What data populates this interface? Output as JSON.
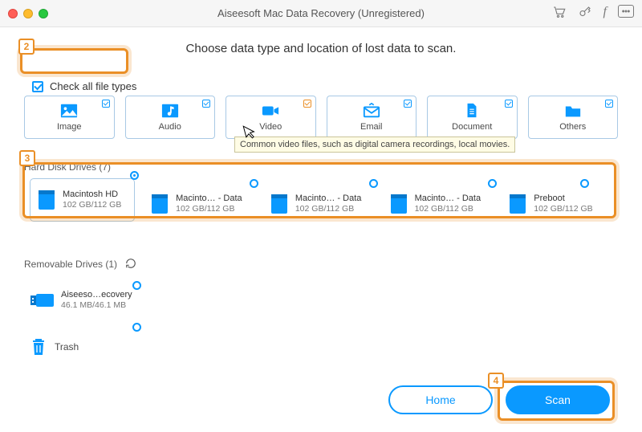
{
  "window": {
    "title": "Aiseesoft Mac Data Recovery (Unregistered)"
  },
  "instruction": "Choose data type and location of lost data to scan.",
  "checkAllLabel": "Check all file types",
  "fileTypes": [
    {
      "label": "Image"
    },
    {
      "label": "Audio"
    },
    {
      "label": "Video"
    },
    {
      "label": "Email"
    },
    {
      "label": "Document"
    },
    {
      "label": "Others"
    }
  ],
  "tooltip": "Common video files, such as digital camera recordings, local movies.",
  "sections": {
    "hdd": "Hard Disk Drives (7)",
    "removable": "Removable Drives (1)",
    "trash": "Trash"
  },
  "hddDrives": [
    {
      "name": "Macintosh HD",
      "size": "102 GB/112 GB",
      "selected": true
    },
    {
      "name": "Macinto… - Data",
      "size": "102 GB/112 GB",
      "selected": false
    },
    {
      "name": "Macinto… - Data",
      "size": "102 GB/112 GB",
      "selected": false
    },
    {
      "name": "Macinto… - Data",
      "size": "102 GB/112 GB",
      "selected": false
    },
    {
      "name": "Preboot",
      "size": "102 GB/112 GB",
      "selected": false
    }
  ],
  "removableDrives": [
    {
      "name": "Aiseeso…ecovery",
      "size": "46.1 MB/46.1 MB"
    }
  ],
  "buttons": {
    "home": "Home",
    "scan": "Scan"
  },
  "annotations": {
    "step2": "2",
    "step3": "3",
    "step4": "4"
  }
}
